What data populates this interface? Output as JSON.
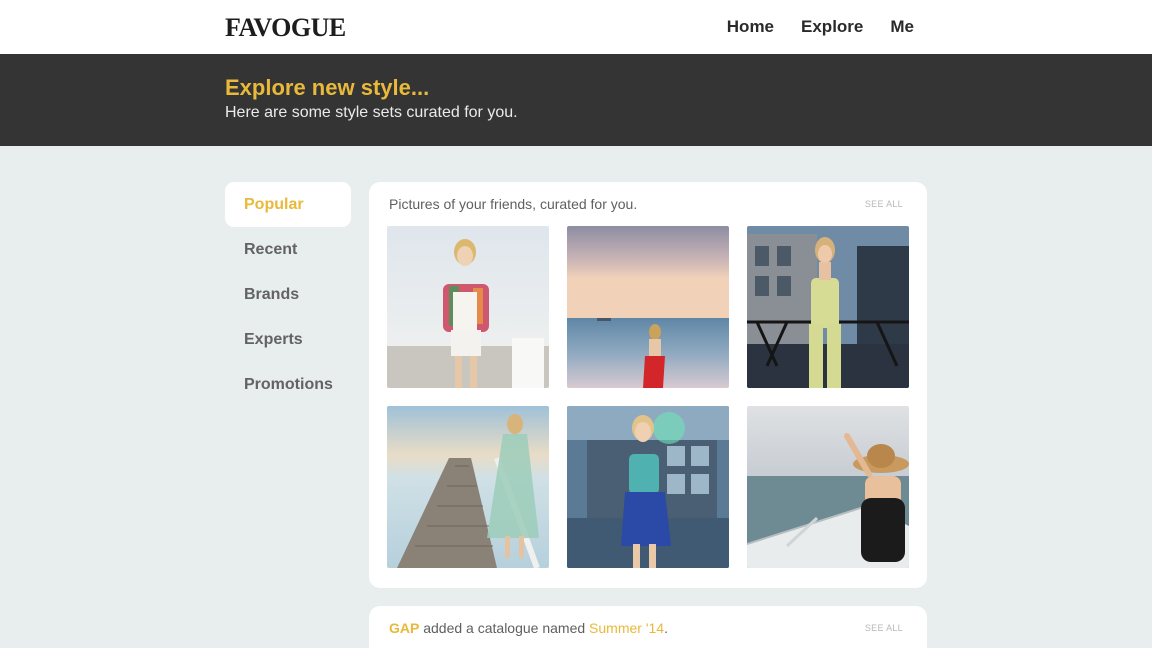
{
  "header": {
    "logo": "FAVOGUE",
    "nav": [
      "Home",
      "Explore",
      "Me"
    ]
  },
  "hero": {
    "title": "Explore new style...",
    "subtitle": "Here are some style sets curated for you."
  },
  "sidebar": {
    "items": [
      {
        "label": "Popular",
        "active": true
      },
      {
        "label": "Recent"
      },
      {
        "label": "Brands"
      },
      {
        "label": "Experts"
      },
      {
        "label": "Promotions"
      }
    ]
  },
  "feed": {
    "cards": [
      {
        "heading": "Pictures of your friends, curated for you.",
        "see_all": "SEE ALL",
        "photos": [
          "woman-floral-jacket-photo",
          "woman-red-dress-sunset-sea-photo",
          "woman-yellow-jumpsuit-railing-photo",
          "woman-mint-dress-pier-photo",
          "woman-blue-skirt-harbour-photo",
          "woman-sun-hat-boat-photo"
        ]
      },
      {
        "brand": "GAP",
        "text": "added a catalogue named",
        "catalogue": "Summer '14",
        "end": ".",
        "see_all": "SEE ALL"
      }
    ]
  },
  "colors": {
    "accent": "#e8b93a",
    "hero_bg": "#333433",
    "page_bg": "#e8eded"
  }
}
